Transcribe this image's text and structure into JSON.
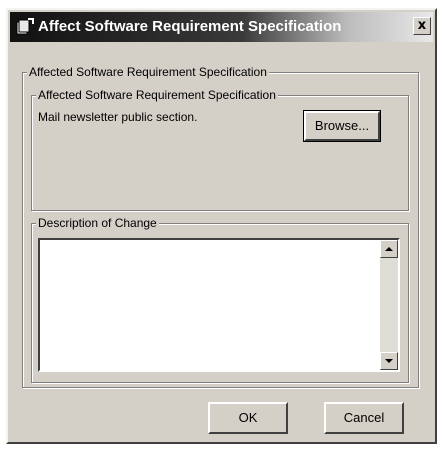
{
  "window": {
    "title": "Affect Software Requirement Specification",
    "close_symbol": "x"
  },
  "outer_group": {
    "label": "Affected Software Requirement Specification"
  },
  "spec_group": {
    "label": "Affected Software Requirement Specification",
    "selected_text": "Mail newsletter public section.",
    "browse_label": "Browse..."
  },
  "change_group": {
    "label": "Description of Change",
    "value": ""
  },
  "footer": {
    "ok_label": "OK",
    "cancel_label": "Cancel"
  },
  "icons": {
    "app": "app-icon",
    "close": "close-icon",
    "scroll_up": "scroll-up-arrow-icon",
    "scroll_down": "scroll-down-arrow-icon"
  }
}
